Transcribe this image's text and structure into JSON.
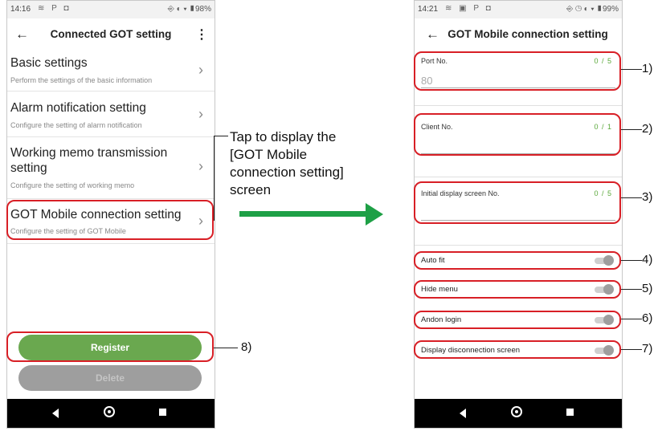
{
  "left_screen": {
    "status": {
      "time": "14:16",
      "icons": "≋ P ◘",
      "right": "⎆ ◐ ▾ ▮98%"
    },
    "title": "Connected GOT setting",
    "items": [
      {
        "title": "Basic settings",
        "subtitle": "Perform the settings of the basic information"
      },
      {
        "title": "Alarm notification setting",
        "subtitle": "Configure the setting of alarm notification"
      },
      {
        "title": "Working memo transmission setting",
        "subtitle": "Configure the setting of working memo"
      },
      {
        "title": "GOT Mobile connection setting",
        "subtitle": "Configure the setting of GOT Mobile"
      }
    ],
    "register_label": "Register",
    "delete_label": "Delete",
    "colors": {
      "register": "#6aa84f",
      "delete": "#9e9e9e",
      "highlight": "#d81f26"
    }
  },
  "right_screen": {
    "status": {
      "time": "14:21",
      "icons": "≋ ▣ P ◘",
      "right": "⎆ ◷ ◐ ▾ ▮99%"
    },
    "title": "GOT Mobile connection setting",
    "fields": [
      {
        "label": "Port No.",
        "count": "0 / 5",
        "value": "80"
      },
      {
        "label": "Client No.",
        "count": "0 / 1",
        "value": ""
      },
      {
        "label": "Initial display screen No.",
        "count": "0 / 5",
        "value": ""
      }
    ],
    "toggles": [
      {
        "label": "Auto fit",
        "on": false
      },
      {
        "label": "Hide menu",
        "on": false
      },
      {
        "label": "Andon login",
        "on": false
      },
      {
        "label": "Display disconnection screen",
        "on": false
      }
    ]
  },
  "instruction": {
    "line1": "Tap to display the",
    "line2": "[GOT Mobile",
    "line3": "connection setting]",
    "line4": "screen",
    "arrow_color": "#1ea046"
  },
  "callouts": [
    "1)",
    "2)",
    "3)",
    "4)",
    "5)",
    "6)",
    "7)",
    "8)"
  ]
}
